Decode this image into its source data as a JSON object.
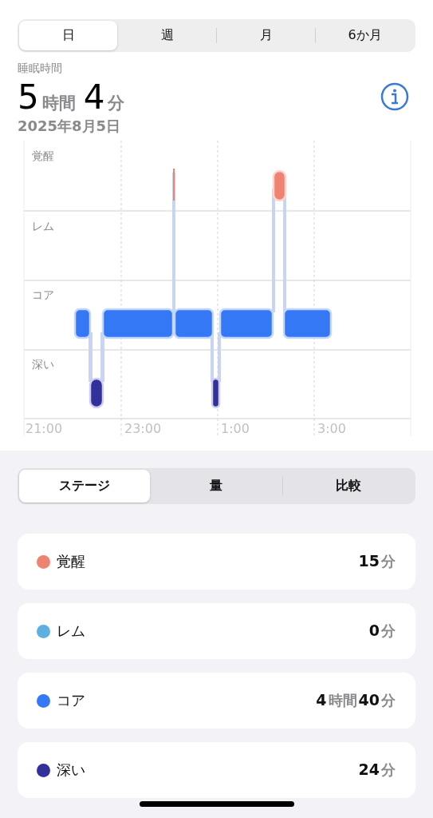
{
  "period_tabs": [
    {
      "label": "日",
      "selected": true
    },
    {
      "label": "週",
      "selected": false
    },
    {
      "label": "月",
      "selected": false
    },
    {
      "label": "6か月",
      "selected": false
    }
  ],
  "summary": {
    "title": "睡眠時間",
    "total": [
      {
        "text": "5",
        "kind": "number"
      },
      {
        "text": "時間",
        "kind": "unit"
      },
      {
        "text": "4",
        "kind": "number"
      },
      {
        "text": "分",
        "kind": "unit"
      }
    ],
    "date": "2025年8月5日"
  },
  "chart": {
    "stages": [
      "覚醒",
      "レム",
      "コア",
      "深い"
    ],
    "time_ticks": [
      "21:00",
      "23:00",
      "1:00",
      "3:00"
    ]
  },
  "view_tabs": [
    {
      "label": "ステージ",
      "selected": true
    },
    {
      "label": "量",
      "selected": false
    },
    {
      "label": "比較",
      "selected": false
    }
  ],
  "stages": [
    {
      "name": "覚醒",
      "color": "#ee8371",
      "duration": [
        {
          "text": "15",
          "kind": "number"
        },
        {
          "text": "分",
          "kind": "unit"
        }
      ]
    },
    {
      "name": "レム",
      "color": "#5fb0e2",
      "duration": [
        {
          "text": "0",
          "kind": "number"
        },
        {
          "text": "分",
          "kind": "unit"
        }
      ]
    },
    {
      "name": "コア",
      "color": "#3478f6",
      "duration": [
        {
          "text": "4",
          "kind": "number"
        },
        {
          "text": "時間",
          "kind": "unit"
        },
        {
          "text": "40",
          "kind": "number"
        },
        {
          "text": "分",
          "kind": "unit"
        }
      ]
    },
    {
      "name": "深い",
      "color": "#32309a",
      "duration": [
        {
          "text": "24",
          "kind": "number"
        },
        {
          "text": "分",
          "kind": "unit"
        }
      ]
    }
  ]
}
